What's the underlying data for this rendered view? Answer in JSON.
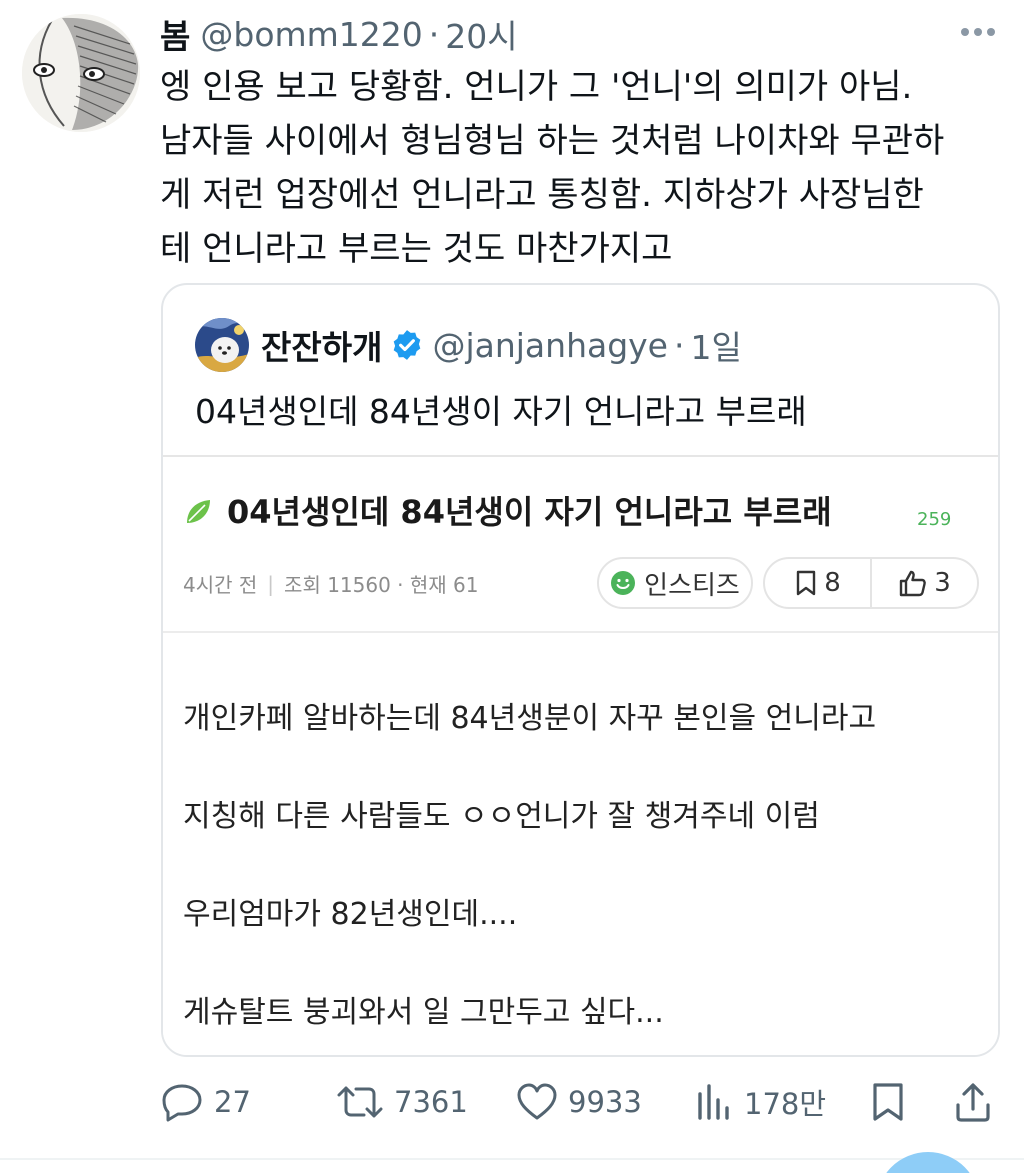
{
  "tweet": {
    "display_name": "봄",
    "handle": "@bomm1220",
    "separator": "·",
    "time": "20시",
    "text_lines": [
      "엥 인용 보고 당황함. 언니가 그 '언니'의 의미가 아님.",
      "남자들 사이에서 형님형님 하는 것처럼 나이차와 무관하",
      "게 저런 업장에선 언니라고 통칭함. 지하상가 사장님한",
      "테 언니라고 부르는 것도 마찬가지고"
    ]
  },
  "quote": {
    "display_name": "잔잔하개",
    "handle": "@janjanhagye",
    "separator": "·",
    "time": "1일",
    "text": "04년생인데 84년생이 자기 언니라고 부르래",
    "attachment": {
      "title": "04년생인데 84년생이 자기 언니라고 부르래",
      "comment_count": "259",
      "meta_time": "4시간 전",
      "meta_sep": "|",
      "meta_views": "조회 11560 · 현재 61",
      "board": "인스티즈",
      "scrap_count": "8",
      "like_count": "3",
      "body_lines": [
        "개인카페 알바하는데 84년생분이 자꾸 본인을 언니라고",
        "지칭해 다른 사람들도 ㅇㅇ언니가 잘 챙겨주네 이럼",
        "우리엄마가 82년생인데....",
        "게슈탈트 붕괴와서 일 그만두고 싶다..."
      ]
    }
  },
  "actions": {
    "replies": "27",
    "retweets": "7361",
    "likes": "9933",
    "views": "178만"
  },
  "colors": {
    "text": "#0f1419",
    "muted": "#536471",
    "verified": "#1d9bf0",
    "border": "#e3e6e9",
    "insti_green": "#4bb35a",
    "fab": "#8ecdf7"
  },
  "icons": [
    "more-icon",
    "verified-icon",
    "leaf-icon",
    "smile-icon",
    "bookmark-icon",
    "thumbs-up-icon",
    "reply-icon",
    "retweet-icon",
    "like-icon",
    "views-icon",
    "share-icon"
  ]
}
